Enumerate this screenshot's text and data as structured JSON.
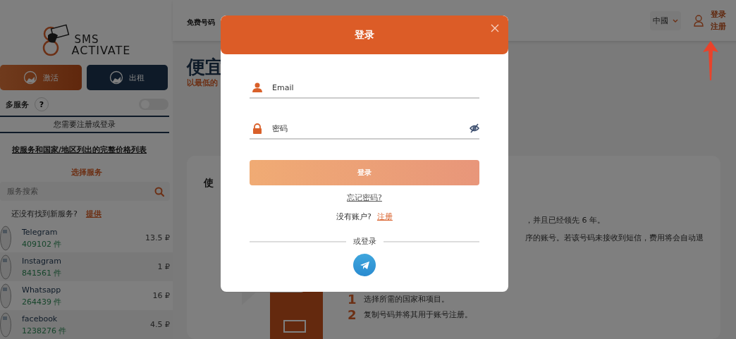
{
  "sidebar": {
    "logo": {
      "line1": "SMS",
      "line2": "ACTIVATE"
    },
    "mode_tabs": [
      {
        "label": "激活",
        "selected": true
      },
      {
        "label": "出租",
        "selected": false
      }
    ],
    "multi_service": {
      "label": "多服务",
      "help": "?",
      "on": false
    },
    "auth_notice": "您需要注册或登录",
    "price_list_link": "按服务和国家/地区列出的完整价格列表",
    "choose_service": "选择服务",
    "search": {
      "placeholder": "服务搜索"
    },
    "suggest": {
      "text": "还没有找到新服务?",
      "link": "提供"
    },
    "services": [
      {
        "name": "Telegram",
        "count": "409102 件",
        "price": "13.5 ₽"
      },
      {
        "name": "Instagram",
        "count": "841561 件",
        "price": "1 ₽"
      },
      {
        "name": "Whatsapp",
        "count": "264439 件",
        "price": "16 ₽"
      },
      {
        "name": "facebook",
        "count": "1238276 件",
        "price": "4.5 ₽"
      }
    ]
  },
  "header": {
    "nav": [
      "免费号码"
    ],
    "country": "中國",
    "login": "登录",
    "register": "注册"
  },
  "main": {
    "heading": "便宜",
    "subtitle": "以最低的",
    "card": {
      "title": "使",
      "lines": [
        "，并且已经领先 6 年。",
        "序的账号。若该号码未接收到短信，费用将会自动退"
      ],
      "steps": [
        {
          "number": "1",
          "text": "选择所需的国家和项目。"
        },
        {
          "number": "2",
          "text": "复制号码并将其用于账号注册。"
        }
      ]
    }
  },
  "modal": {
    "title": "登录",
    "fields": [
      {
        "kind": "email",
        "placeholder": "Email"
      },
      {
        "kind": "password",
        "placeholder": "密码"
      }
    ],
    "submit": "登录",
    "forgot": "忘记密码? ",
    "no_account": "没有账户?",
    "register": "注册",
    "divider": "或登录"
  }
}
